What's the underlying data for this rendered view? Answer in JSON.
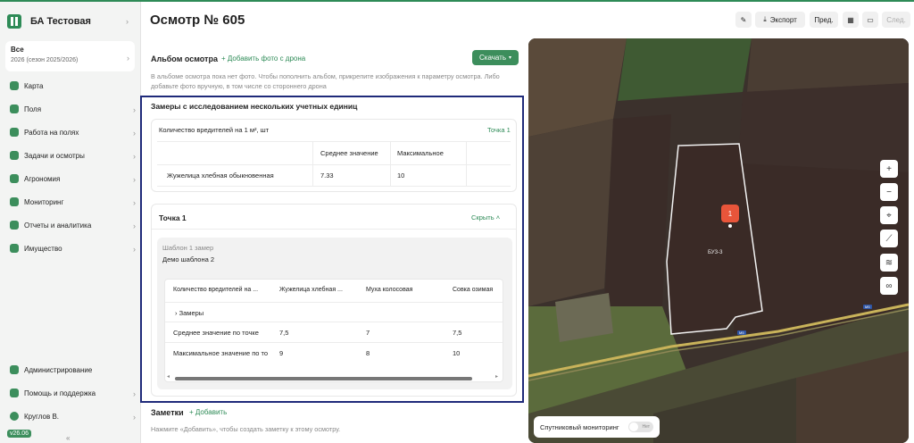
{
  "sidebar": {
    "brand": "БА Тестовая",
    "season_title": "Все",
    "season_sub": "2026 (сезон 2025/2026)",
    "items": [
      "Карта",
      "Поля",
      "Работа на полях",
      "Задачи и осмотры",
      "Агрономия",
      "Мониторинг",
      "Отчеты и аналитика",
      "Имущество"
    ],
    "bottom": [
      "Администрирование",
      "Помощь и поддержка",
      "Круглов В."
    ],
    "version": "v26.06",
    "collapse": "«"
  },
  "header": {
    "title": "Осмотр № 605",
    "export": "Экспорт",
    "prev": "Пред.",
    "next": "След."
  },
  "album": {
    "title": "Альбом осмотра",
    "add": "Добавить фото с дрона",
    "download": "Скачать",
    "note1": "В альбоме осмотра пока нет фото. Чтобы пополнить альбом, прикрепите изображения к параметру осмотра. Либо",
    "note2": "добавьте фото вручную, в том числе со стороннего дрона"
  },
  "measure": {
    "title": "Замеры с исследованием нескольких учетных единиц",
    "pest": "Количество вредителей на 1 м², шт",
    "point_link": "Точка 1",
    "col_avg": "Среднее значение",
    "col_max": "Максимальное",
    "row_name": "Жужелица хлебная обыкновенная",
    "row_avg": "7.33",
    "row_max": "10"
  },
  "point": {
    "title": "Точка 1",
    "hide": "Скрыть",
    "template_label": "Шаблон 1 замер",
    "template_name": "Демо шаблона 2",
    "headers": [
      "Количество вредителей на ...",
      "Жужелица хлебная ...",
      "Муха колосовая",
      "Совка озимая"
    ],
    "group": "Замеры",
    "rows": [
      {
        "label": "Среднее значение по точке",
        "v": [
          "7,5",
          "7",
          "7,5"
        ]
      },
      {
        "label": "Максимальное значение по то",
        "v": [
          "9",
          "8",
          "10"
        ]
      }
    ]
  },
  "notes": {
    "title": "Заметки",
    "add": "Добавить",
    "hint": "Нажмите «Добавить», чтобы создать заметку к этому осмотру."
  },
  "map": {
    "field": "БУЗ-3",
    "marker": "1",
    "road": "М5",
    "sat": "Спутниковый мониторинг",
    "toggle": "Нет"
  }
}
